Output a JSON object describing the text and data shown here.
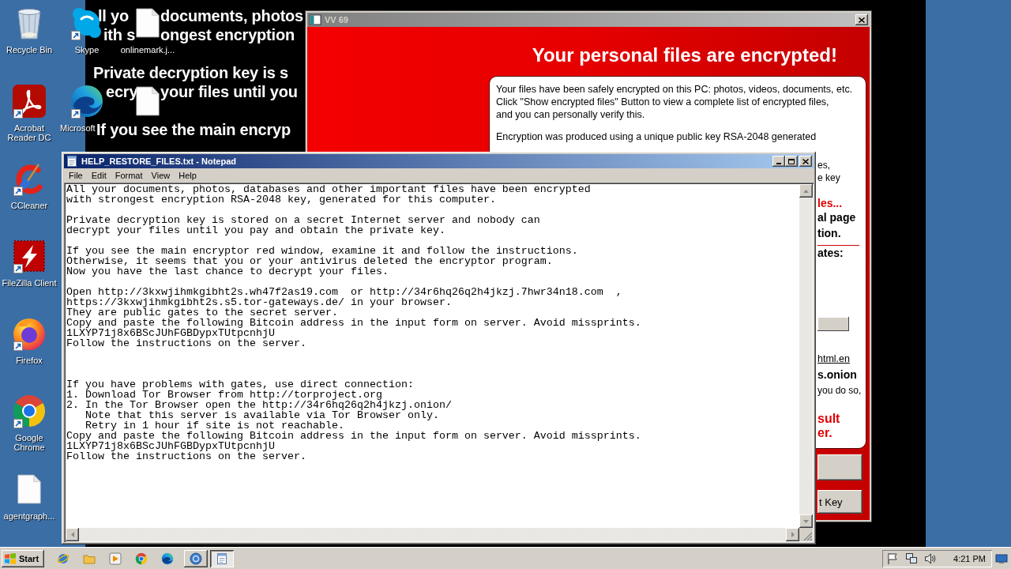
{
  "desktop": {
    "wallpaper_text": [
      [
        "ll yo",
        "documents, photos"
      ],
      [
        "ith s",
        "ongest encryption"
      ],
      [
        "Private decryption key is s"
      ],
      [
        "ecry",
        "your files until you"
      ],
      [
        "If you see the main encryp"
      ]
    ],
    "icons": [
      {
        "label": "Recycle Bin",
        "kind": "program",
        "shortcut": false
      },
      {
        "label": "Acrobat\nReader DC",
        "kind": "program",
        "shortcut": true
      },
      {
        "label": "CCleaner",
        "kind": "program",
        "shortcut": true
      },
      {
        "label": "FileZilla Client",
        "kind": "program",
        "shortcut": true
      },
      {
        "label": "Firefox",
        "kind": "program",
        "shortcut": true
      },
      {
        "label": "Google\nChrome",
        "kind": "program",
        "shortcut": true
      },
      {
        "label": "agentgraph...",
        "kind": "document",
        "shortcut": false
      },
      {
        "label": "Skype",
        "kind": "program",
        "shortcut": true
      },
      {
        "label": "Microsoft",
        "kind": "program",
        "shortcut": true
      },
      {
        "label": "onlinemark.j...",
        "kind": "document",
        "shortcut": false
      },
      {
        "kind": "document",
        "shortcut": false
      }
    ]
  },
  "ransom_window": {
    "title": "VV 69",
    "heading": "Your personal files are encrypted!",
    "paragraphs": [
      "Your files have been safely encrypted on this PC: photos, videos, documents, etc.\nClick \"Show encrypted files\" Button to view a complete list of encrypted files,\nand you can personally verify this.",
      "Encryption was produced using a unique public key RSA-2048 generated"
    ],
    "fragments": [
      {
        "kind": "text",
        "text": "es,"
      },
      {
        "kind": "text",
        "text": "e key"
      },
      {
        "kind": "alert",
        "text": "les..."
      },
      {
        "kind": "bold",
        "text": "al page"
      },
      {
        "kind": "bold",
        "text": "tion."
      },
      {
        "kind": "rule"
      },
      {
        "kind": "bold",
        "text": "ates:"
      },
      {
        "kind": "button"
      },
      {
        "kind": "link",
        "text": "html.en"
      },
      {
        "kind": "bold",
        "text": "s.onion"
      },
      {
        "kind": "text",
        "text": "you do so,"
      },
      {
        "kind": "warning",
        "text": "sult"
      },
      {
        "kind": "warning",
        "text": "er."
      }
    ],
    "buttons": [
      {
        "kind": "blank"
      },
      {
        "kind": "labeled",
        "label": "t Key"
      }
    ]
  },
  "notepad": {
    "title": "HELP_RESTORE_FILES.txt - Notepad",
    "menu": [
      "File",
      "Edit",
      "Format",
      "View",
      "Help"
    ],
    "text": "All your documents, photos, databases and other important files have been encrypted\nwith strongest encryption RSA-2048 key, generated for this computer.\n\nPrivate decryption key is stored on a secret Internet server and nobody can\ndecrypt your files until you pay and obtain the private key.\n\nIf you see the main encryptor red window, examine it and follow the instructions.\nOtherwise, it seems that you or your antivirus deleted the encryptor program.\nNow you have the last chance to decrypt your files.\n\nOpen http://3kxwjihmkgibht2s.wh47f2as19.com  or http://34r6hq26q2h4jkzj.7hwr34n18.com  ,\nhttps://3kxwjihmkgibht2s.s5.tor-gateways.de/ in your browser.\nThey are public gates to the secret server.\nCopy and paste the following Bitcoin address in the input form on server. Avoid missprints.\n1LXYP71j8x6BScJUhFGBDypxTUtpcnhjU\nFollow the instructions on the server.\n\n\n\nIf you have problems with gates, use direct connection:\n1. Download Tor Browser from http://torproject.org\n2. In the Tor Browser open the http://34r6hq26q2h4jkzj.onion/\n   Note that this server is available via Tor Browser only.\n   Retry in 1 hour if site is not reachable.\nCopy and paste the following Bitcoin address in the input form on server. Avoid missprints.\n1LXYP71j8x6BScJUhFGBDypxTUtpcnhjU\nFollow the instructions on the server."
  },
  "taskbar": {
    "start": "Start",
    "tasks": [
      {
        "selected": false
      },
      {
        "selected": true
      }
    ],
    "clock": "4:21 PM"
  }
}
